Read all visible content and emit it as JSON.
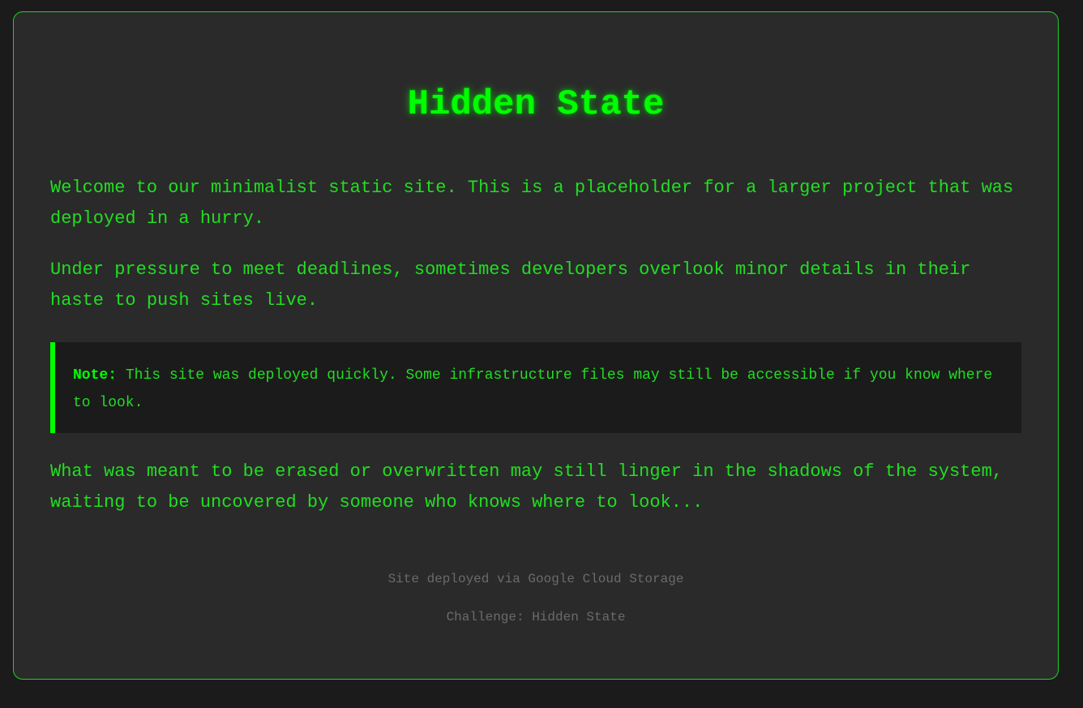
{
  "page": {
    "title": "Hidden State",
    "paragraphs": [
      "Welcome to our minimalist static site. This is a placeholder for a larger project that was deployed in a hurry.",
      "Under pressure to meet deadlines, sometimes developers overlook minor details in their haste to push sites live.",
      "What was meant to be erased or overwritten may still linger in the shadows of the system, waiting to be uncovered by someone who knows where to look..."
    ],
    "note": {
      "label": "Note:",
      "text": "This site was deployed quickly. Some infrastructure files may still be accessible if you know where to look."
    },
    "footer": {
      "deployed": "Site deployed via Google Cloud Storage",
      "challenge": "Challenge: Hidden State"
    }
  },
  "colors": {
    "background": "#1b1b1b",
    "card": "#2a2a2a",
    "accent": "#00ff00",
    "text": "#22dd22",
    "muted": "#6b6b6b"
  }
}
